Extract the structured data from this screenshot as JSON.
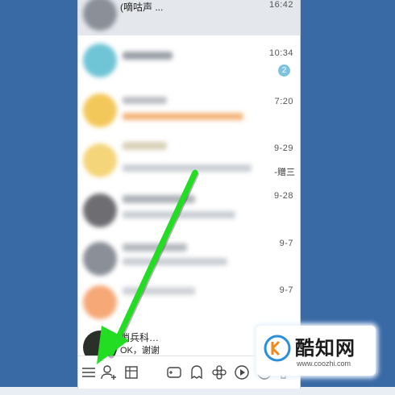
{
  "chats": [
    {
      "name_peek": "(嘀咕声 ...",
      "time": "16:42",
      "selected": true
    },
    {
      "time": "10:34",
      "badge": "2"
    },
    {
      "time": "7:20"
    },
    {
      "time": "9-29",
      "side_note": "-赠三"
    },
    {
      "time": "9-28"
    },
    {
      "time": "9-7"
    },
    {
      "time": "9-7"
    },
    {
      "name_peek": "哨兵科…",
      "preview_peek": "OK，谢谢"
    }
  ],
  "toolbar": {
    "icons": [
      "menu-icon",
      "add-contact-icon",
      "file-icon",
      "game-icon",
      "ghost-icon",
      "flower-icon",
      "play-icon",
      "face-icon",
      "grid-icon"
    ]
  },
  "watermark": {
    "text": "酷知网",
    "url": "www.coozhi.com"
  },
  "colors": {
    "background": "#3a6aa6",
    "arrow": "#22dd22",
    "badge": "#7cc3df"
  }
}
